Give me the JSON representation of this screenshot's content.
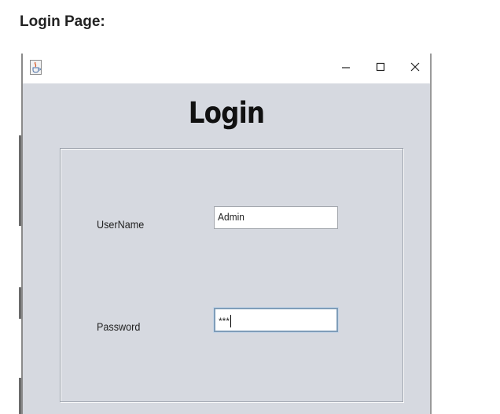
{
  "document": {
    "heading": "Login Page:"
  },
  "window": {
    "icon": "java-cup-icon",
    "controls": {
      "minimize": "minimize-icon",
      "maximize": "maximize-icon",
      "close": "close-icon"
    }
  },
  "login": {
    "title": "Login",
    "username_label": "UserName",
    "username_value": "Admin",
    "password_label": "Password",
    "password_masked": "***"
  },
  "colors": {
    "window_bg": "#d6d9e0",
    "titlebar_bg": "#ffffff",
    "focus_border": "#7f9db9"
  }
}
